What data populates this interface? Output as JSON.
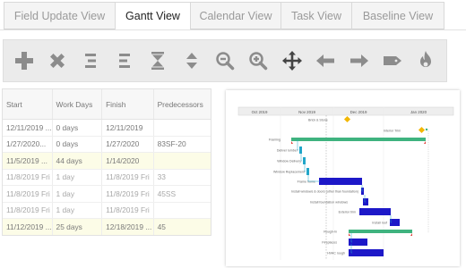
{
  "tabs": [
    {
      "label": "Field Update View",
      "active": false
    },
    {
      "label": "Gantt View",
      "active": true
    },
    {
      "label": "Calendar View",
      "active": false
    },
    {
      "label": "Task View",
      "active": false
    },
    {
      "label": "Baseline View",
      "active": false
    }
  ],
  "toolbar": {
    "icons": [
      "add-icon",
      "delete-icon",
      "indent-icon",
      "outdent-icon",
      "collapse-icon",
      "expand-icon",
      "zoom-out-icon",
      "zoom-in-icon",
      "move-icon",
      "arrow-left-icon",
      "arrow-right-icon",
      "tag-icon",
      "fire-icon"
    ],
    "icon_color": "#8c8c8c"
  },
  "grid": {
    "columns": [
      "Start",
      "Work Days",
      "Finish",
      "Predecessors"
    ],
    "rows": [
      {
        "start": "12/11/2019 ...",
        "work_days": "0 days",
        "finish": "12/11/2019",
        "pred": "",
        "highlight": false,
        "dim": false
      },
      {
        "start": "1/27/2020...",
        "work_days": "0 days",
        "finish": "1/27/2020",
        "pred": "83SF-20",
        "highlight": false,
        "dim": false
      },
      {
        "start": "11/5/2019 ...",
        "work_days": "44 days",
        "finish": "1/14/2020",
        "pred": "",
        "highlight": true,
        "dim": false
      },
      {
        "start": "11/8/2019 Fri",
        "work_days": "1 day",
        "finish": "11/8/2019 Fri",
        "pred": "33",
        "highlight": false,
        "dim": true
      },
      {
        "start": "11/8/2019 Fri",
        "work_days": "1 day",
        "finish": "11/8/2019 Fri",
        "pred": "45SS",
        "highlight": false,
        "dim": true
      },
      {
        "start": "11/8/2019 Fri",
        "work_days": "1 day",
        "finish": "11/8/2019 Fri",
        "pred": "",
        "highlight": false,
        "dim": true
      },
      {
        "start": "11/12/2019 ...",
        "work_days": "25 days",
        "finish": "12/18/2019 ...",
        "pred": "45",
        "highlight": true,
        "dim": false
      }
    ]
  },
  "gantt": {
    "months": [
      "Oct 2019",
      "Nov 2019",
      "Dec 2019",
      "Jan 2020"
    ],
    "colors": {
      "green": "#3fb37f",
      "blue": "#1d18c8",
      "red": "#e0403a",
      "gold": "#f2b705",
      "teal": "#21a6c9"
    },
    "tasks": [
      {
        "label": "Brick & Stone"
      },
      {
        "label": "Interior Trim"
      },
      {
        "label": "Framing"
      },
      {
        "label": "Deliver lumber"
      },
      {
        "label": "Window Delivery"
      },
      {
        "label": "Window Replacement"
      },
      {
        "label": "Frame home"
      },
      {
        "label": "Install windows & doors (other than foundation)"
      },
      {
        "label": "Install foundation windows"
      },
      {
        "label": "Exterior trim"
      },
      {
        "label": "Install roof"
      },
      {
        "label": "Rough-In"
      },
      {
        "label": "Fireplaces"
      },
      {
        "label": "HVAC rough"
      }
    ]
  }
}
